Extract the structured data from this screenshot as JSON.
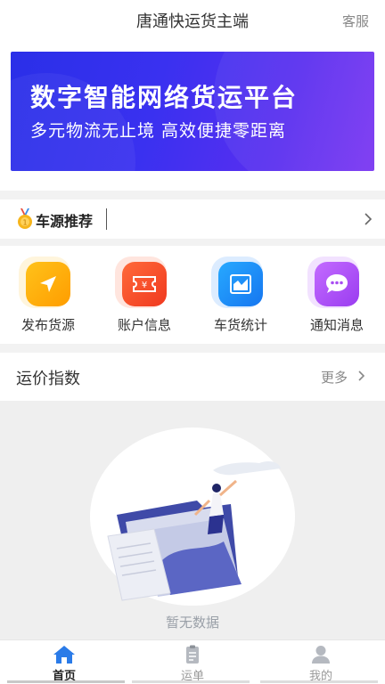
{
  "header": {
    "title": "唐通快运货主端",
    "service_label": "客服"
  },
  "banner": {
    "line1": "数字智能网络货运平台",
    "line2": "多元物流无止境  高效便捷零距离"
  },
  "recommend": {
    "label": "车源推荐"
  },
  "menu": {
    "items": [
      {
        "label": "发布货源",
        "icon": "send-icon"
      },
      {
        "label": "账户信息",
        "icon": "ticket-yen-icon"
      },
      {
        "label": "车货统计",
        "icon": "chart-icon"
      },
      {
        "label": "通知消息",
        "icon": "chat-icon"
      }
    ]
  },
  "freight": {
    "title": "运价指数",
    "more_label": "更多"
  },
  "empty": {
    "message": "暂无数据"
  },
  "tabs": [
    {
      "label": "首页",
      "icon": "home-icon",
      "active": true
    },
    {
      "label": "运单",
      "icon": "clipboard-icon",
      "active": false
    },
    {
      "label": "我的",
      "icon": "user-icon",
      "active": false
    }
  ],
  "colors": {
    "accent": "#2a7be8",
    "banner_start": "#2a2fe8",
    "banner_end": "#7a36f2"
  }
}
